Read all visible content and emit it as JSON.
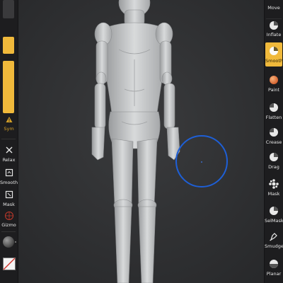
{
  "left_toolbar": {
    "sym_label": "Sym",
    "relax_label": "Relax",
    "smooth_label": "Smooth",
    "mask_label": "Mask",
    "gizmo_label": "Gizmo"
  },
  "right_toolbar": {
    "tools": [
      {
        "label": "Move",
        "icon": "move-brush-icon",
        "active": false
      },
      {
        "label": "Inflate",
        "icon": "inflate-brush-icon",
        "active": false
      },
      {
        "label": "Smooth",
        "icon": "smooth-brush-icon",
        "active": true
      },
      {
        "label": "Paint",
        "icon": "paint-brush-icon",
        "active": false
      },
      {
        "label": "Flatten",
        "icon": "flatten-brush-icon",
        "active": false
      },
      {
        "label": "Crease",
        "icon": "crease-brush-icon",
        "active": false
      },
      {
        "label": "Drag",
        "icon": "drag-brush-icon",
        "active": false
      },
      {
        "label": "Mask",
        "icon": "mask-brush-icon",
        "active": false
      },
      {
        "label": "SelMask",
        "icon": "selmask-brush-icon",
        "active": false
      },
      {
        "label": "Smudge",
        "icon": "smudge-brush-icon",
        "active": false
      },
      {
        "label": "Planar",
        "icon": "planar-brush-icon",
        "active": false
      }
    ]
  },
  "colors": {
    "accent": "#f0b93b",
    "toolbar_bg": "#1d1d1f",
    "brush_cursor": "#1e5fd6",
    "sym_warning": "#d4a028"
  }
}
